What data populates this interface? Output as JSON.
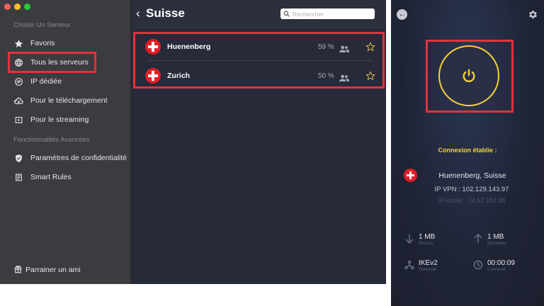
{
  "sidebar": {
    "section_title": "Choisir Un Serveur",
    "items": [
      {
        "label": "Favoris",
        "icon": "star-icon"
      },
      {
        "label": "Tous les serveurs",
        "icon": "globe-icon"
      },
      {
        "label": "IP dédiée",
        "icon": "ip-icon"
      },
      {
        "label": "Pour le téléchargement",
        "icon": "cloud-download-icon"
      },
      {
        "label": "Pour le streaming",
        "icon": "play-icon"
      }
    ],
    "advanced_title": "Fonctionnalités Avancées",
    "advanced_items": [
      {
        "label": "Paramètres de confidentialité",
        "icon": "shield-icon"
      },
      {
        "label": "Smart Rules",
        "icon": "list-icon"
      }
    ],
    "footer_label": "Parrainer un ami",
    "highlight_color": "#e0333c"
  },
  "main": {
    "title": "Suisse",
    "search_placeholder": "Rechercher",
    "servers": [
      {
        "name": "Huenenberg",
        "load": "59 %"
      },
      {
        "name": "Zurich",
        "load": "50 %"
      }
    ]
  },
  "connection": {
    "status": "Connexion établie :",
    "location": "Huenenberg, Suisse",
    "ip_vpn": "IP VPN : 102.129.143.97",
    "ip_local": "IP locale : 74.57.184.98",
    "received_value": "1 MB",
    "received_label": "Reçues",
    "sent_value": "1 MB",
    "sent_label": "Envoyées",
    "protocol_value": "IKEv2",
    "protocol_label": "Protocole",
    "time_value": "00:00:09",
    "time_label": "Connecté",
    "accent_color": "#f2d33a"
  }
}
